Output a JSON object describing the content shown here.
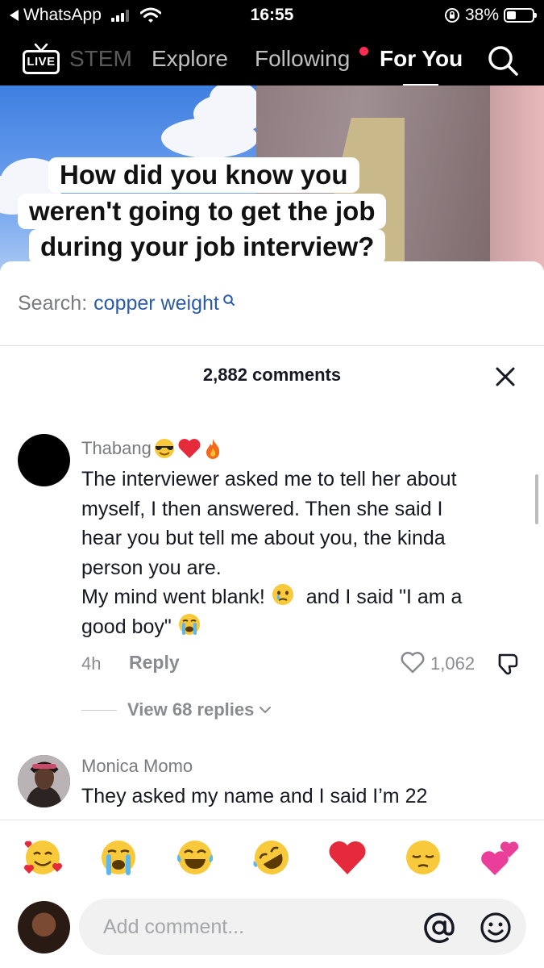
{
  "status_bar": {
    "back_app": "WhatsApp",
    "time": "16:55",
    "battery": "38%"
  },
  "top_nav": {
    "live_label": "LIVE",
    "tabs": [
      {
        "label": "STEM"
      },
      {
        "label": "Explore"
      },
      {
        "label": "Following"
      },
      {
        "label": "For You"
      }
    ],
    "active_tab": "For You"
  },
  "video": {
    "caption_lines": [
      "How did you know you",
      "weren't going to get the job",
      "during your job interview?"
    ]
  },
  "comments_sheet": {
    "search_prefix": "Search:",
    "search_term": "copper weight",
    "count_label": "2,882 comments",
    "comments": [
      {
        "username": "Thabang",
        "username_emojis": [
          "smiling-face-with-sunglasses",
          "red-heart",
          "fire"
        ],
        "text_lines": [
          "The interviewer asked me to tell her about",
          "myself, I then answered. Then she said I",
          "hear you but tell me about you, the kinda",
          "person you are.",
          "My mind went blank!",
          "and I said \"I am a",
          "good boy\""
        ],
        "time": "4h",
        "reply_label": "Reply",
        "likes": "1,062",
        "view_replies": "View 68 replies"
      },
      {
        "username": "Monica Momo",
        "text": "They asked my name and I said I’m 22"
      }
    ]
  },
  "emoji_bar": [
    "smiling-face-with-hearts",
    "loudly-crying-face",
    "face-with-tears-of-joy",
    "rolling-on-floor-laughing",
    "red-heart",
    "pensive-face",
    "two-hearts"
  ],
  "input": {
    "placeholder": "Add comment..."
  }
}
